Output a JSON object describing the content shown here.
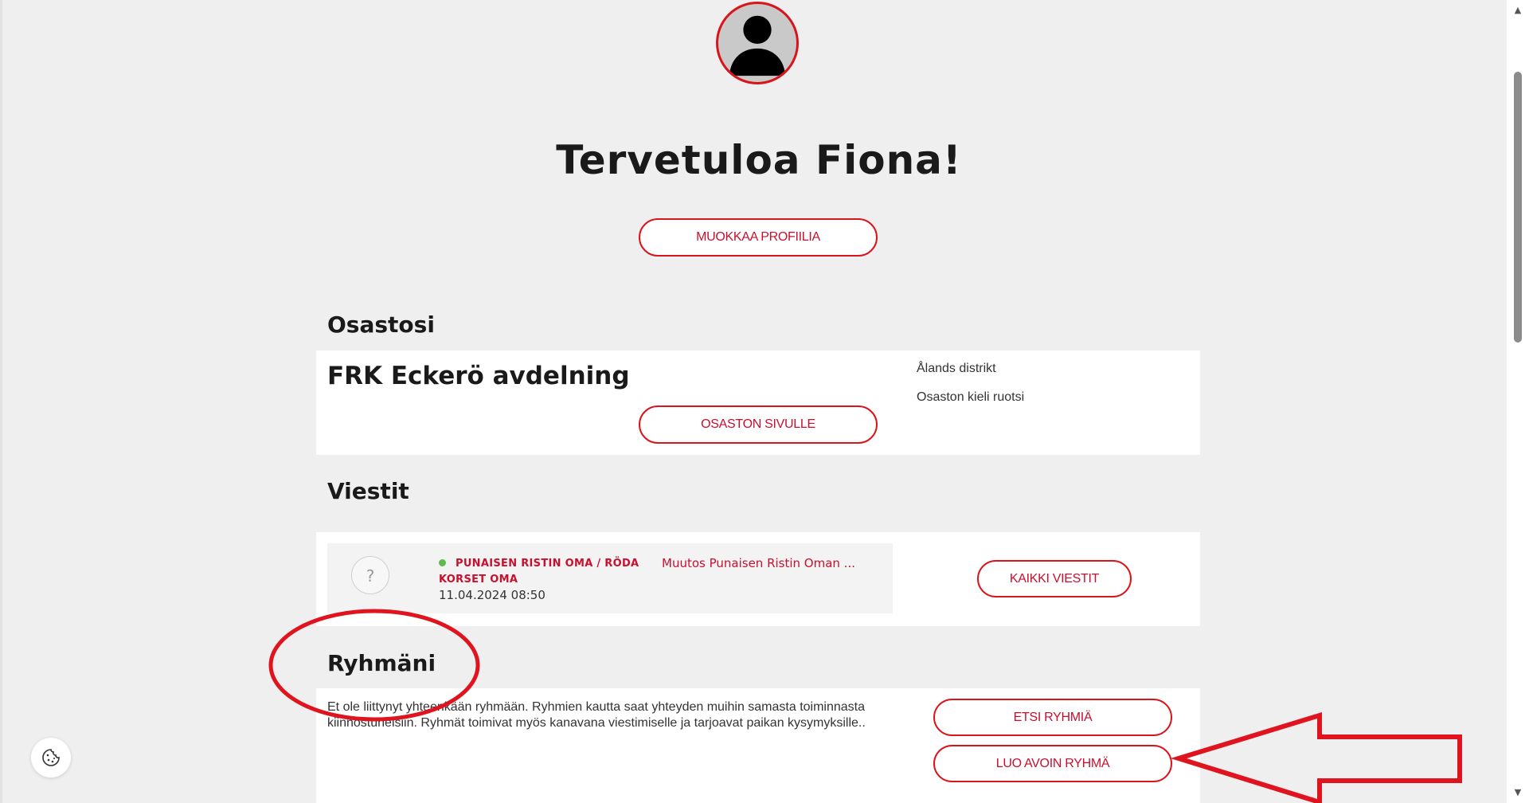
{
  "profile": {
    "welcome": "Tervetuloa Fiona!",
    "edit_button": "MUOKKAA PROFIILIA"
  },
  "department": {
    "section_title": "Osastosi",
    "name": "FRK Eckerö avdelning",
    "district": "Ålands distrikt",
    "language": "Osaston kieli ruotsi",
    "page_button": "OSASTON SIVULLE"
  },
  "messages": {
    "section_title": "Viestit",
    "item": {
      "avatar": "?",
      "sender": "PUNAISEN RISTIN OMA / RÖDA KORSET OMA",
      "date": "11.04.2024 08:50",
      "subject": "Muutos Punaisen Ristin Oman ..."
    },
    "all_button": "KAIKKI VIESTIT"
  },
  "groups": {
    "section_title": "Ryhmäni",
    "description": "Et ole liittynyt yhteenkään ryhmään. Ryhmien kautta saat yhteyden muihin samasta toiminnasta kiinnostuneisiin. Ryhmät toimivat myös kanavana viestimiselle ja tarjoavat paikan kysymyksille..",
    "find_button": "ETSI RYHMIÄ",
    "create_button": "LUO AVOIN RYHMÄ"
  },
  "colors": {
    "accent": "#d9141b",
    "online": "#5fb94f",
    "annotation": "#e0141e"
  },
  "icons": {
    "avatar": "user-silhouette-icon",
    "cookie": "cookie-icon"
  }
}
